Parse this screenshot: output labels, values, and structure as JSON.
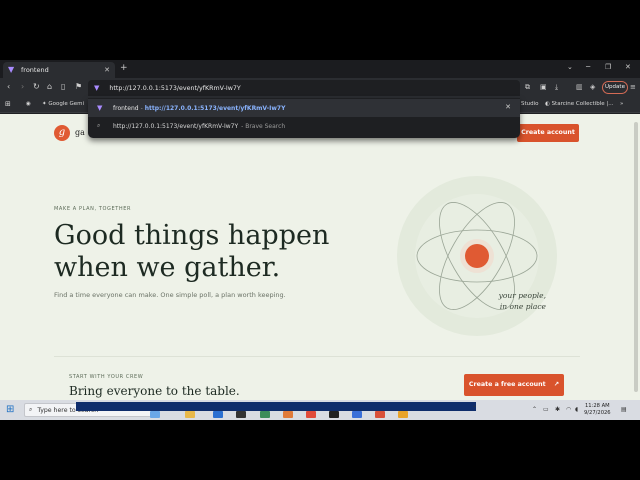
{
  "browser": {
    "tab": {
      "title": "frontend"
    },
    "url": "http://127.0.0.1:5173/event/yfKRmV-Iw7Y",
    "update_label": "Update",
    "bookmarks": [
      "Google Gemi",
      "Studio",
      "Starcine Collectible |..."
    ]
  },
  "omnibox": {
    "suggestion_1": {
      "label": "frontend",
      "separator": "-",
      "url": "http://127.0.0.1:5173/event/yfKRmV-Iw7Y"
    },
    "suggestion_2": {
      "text": "http://127.0.0.1:5173/event/yfKRmV-Iw7Y",
      "suffix": "- Brave Search"
    }
  },
  "page": {
    "brand": "ga",
    "logo_letter": "g",
    "create_account_label": "Create account",
    "eyebrow": "MAKE A PLAN, TOGETHER",
    "headline_line1": "Good things happen",
    "headline_line2": "when we gather.",
    "subcopy": "Find a time everyone can make. One simple poll, a plan worth keeping.",
    "caption_line1": "your people,",
    "caption_line2": "in one place",
    "section_eyebrow": "START WITH YOUR CREW",
    "section_title": "Bring everyone to the table.",
    "create_free_label": "Create a free account",
    "accent_color": "#d9532c"
  },
  "taskbar": {
    "search_placeholder": "Type here to search",
    "time": "11:28 AM",
    "date": "9/27/2026"
  }
}
